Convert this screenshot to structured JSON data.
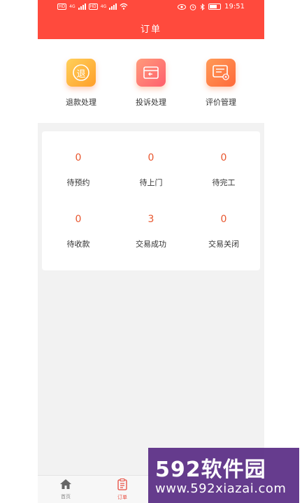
{
  "status": {
    "time": "19:51",
    "hd1": "HD",
    "hd2": "HD",
    "sig1": "4G",
    "sig2": "4G"
  },
  "header": {
    "title": "订单"
  },
  "quick_actions": [
    {
      "label": "退款处理",
      "icon": "refund-icon",
      "icon_text": "退"
    },
    {
      "label": "投诉处理",
      "icon": "complaint-icon"
    },
    {
      "label": "评价管理",
      "icon": "review-icon"
    }
  ],
  "stats": [
    {
      "value": "0",
      "label": "待预约"
    },
    {
      "value": "0",
      "label": "待上门"
    },
    {
      "value": "0",
      "label": "待完工"
    },
    {
      "value": "0",
      "label": "待收款"
    },
    {
      "value": "3",
      "label": "交易成功"
    },
    {
      "value": "0",
      "label": "交易关闭"
    }
  ],
  "tabs": [
    {
      "label": "首页",
      "icon": "home-icon"
    },
    {
      "label": "订单",
      "icon": "order-icon"
    }
  ],
  "watermark": {
    "title": "592软件园",
    "url": "www.592xiazai.com"
  },
  "colors": {
    "accent": "#ff4a3d",
    "number": "#e8562e",
    "watermark": "#5b2e86"
  }
}
